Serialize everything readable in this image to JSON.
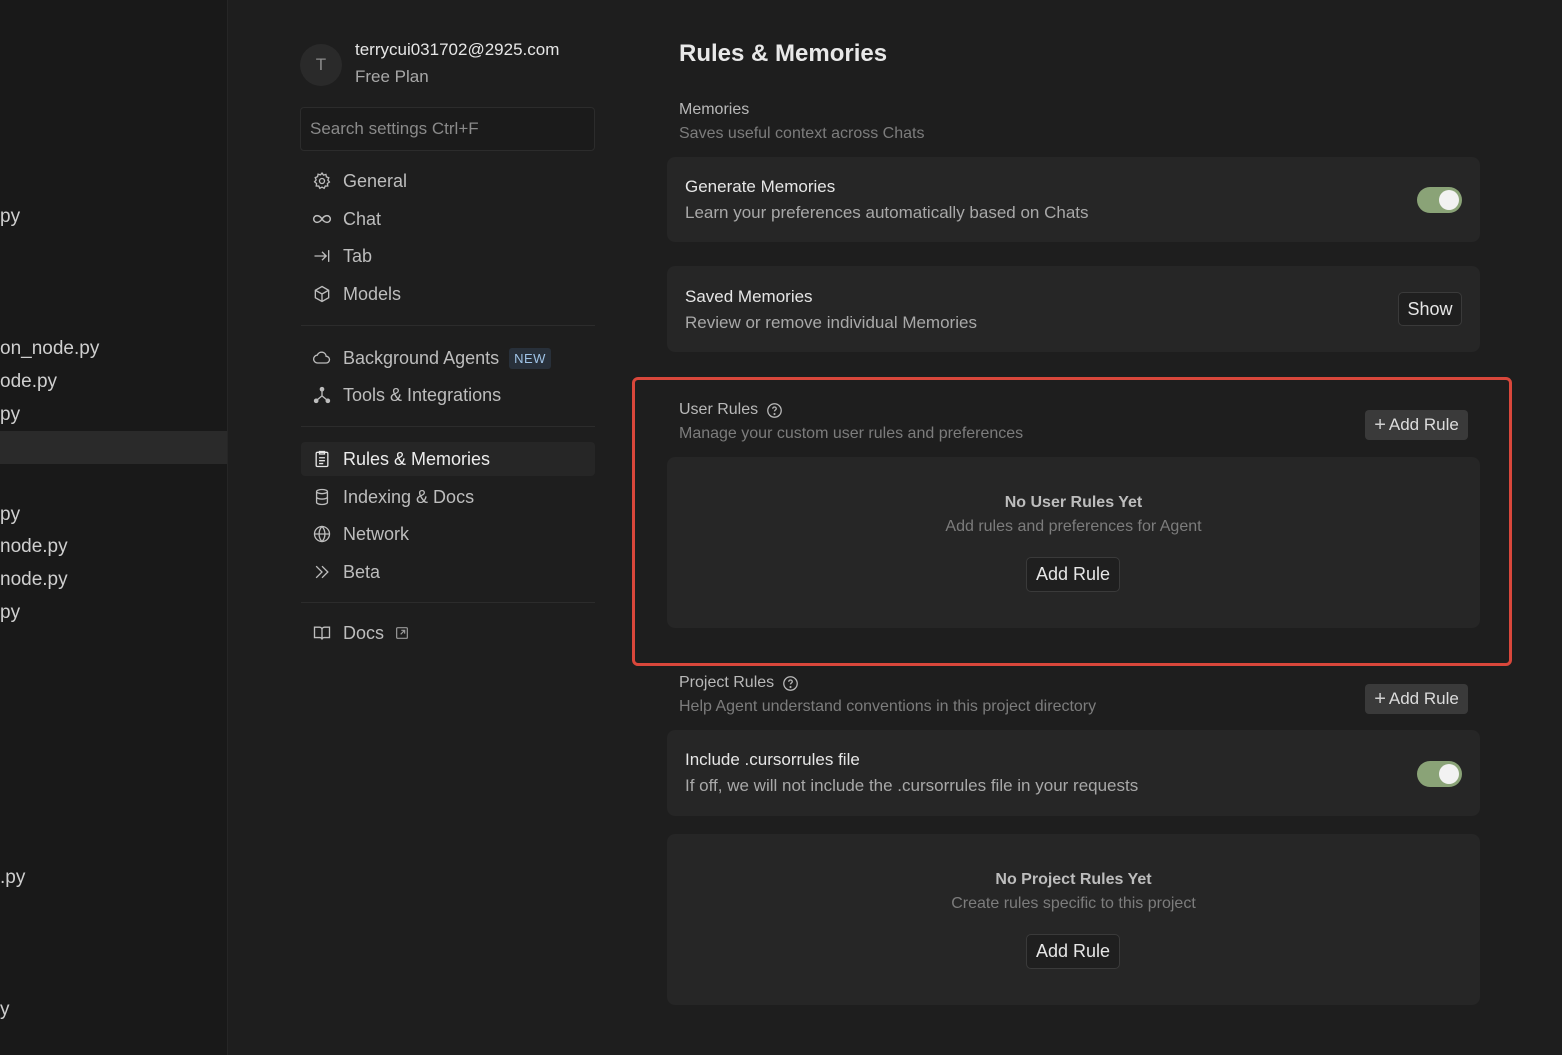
{
  "explorer": {
    "files": [
      "py",
      "on_node.py",
      "ode.py",
      "py",
      "py",
      "node.py",
      "node.py",
      "py",
      ".py",
      "y"
    ]
  },
  "account": {
    "avatar_letter": "T",
    "email": "terrycui031702@2925.com",
    "plan": "Free Plan"
  },
  "search": {
    "placeholder": "Search settings Ctrl+F"
  },
  "nav": {
    "general": "General",
    "chat": "Chat",
    "tab": "Tab",
    "models": "Models",
    "background_agents": "Background Agents",
    "new_badge": "NEW",
    "tools": "Tools & Integrations",
    "rules": "Rules & Memories",
    "indexing": "Indexing & Docs",
    "network": "Network",
    "beta": "Beta",
    "docs": "Docs"
  },
  "main": {
    "title": "Rules & Memories",
    "memories": {
      "title": "Memories",
      "subtitle": "Saves useful context across Chats",
      "generate": {
        "title": "Generate Memories",
        "desc": "Learn your preferences automatically based on Chats",
        "enabled": true
      },
      "saved": {
        "title": "Saved Memories",
        "desc": "Review or remove individual Memories",
        "button": "Show"
      }
    },
    "user_rules": {
      "title": "User Rules",
      "subtitle": "Manage your custom user rules and preferences",
      "add_label": "Add Rule",
      "empty_title": "No User Rules Yet",
      "empty_desc": "Add rules and preferences for Agent",
      "empty_button": "Add Rule"
    },
    "project_rules": {
      "title": "Project Rules",
      "subtitle": "Help Agent understand conventions in this project directory",
      "add_label": "Add Rule",
      "cursorrules": {
        "title": "Include .cursorrules file",
        "desc": "If off, we will not include the .cursorrules file in your requests",
        "enabled": true
      },
      "empty_title": "No Project Rules Yet",
      "empty_desc": "Create rules specific to this project",
      "empty_button": "Add Rule"
    }
  },
  "colors": {
    "toggle_on": "#8aa377",
    "highlight": "#d9473b",
    "badge_text": "#9fc3e6"
  }
}
